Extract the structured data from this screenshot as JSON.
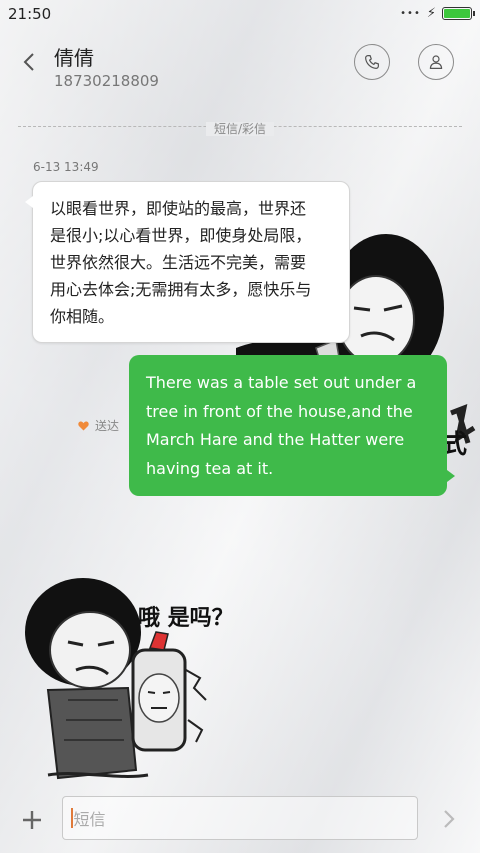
{
  "status_bar": {
    "time": "21:50",
    "dots": "•••",
    "charging": "⚡",
    "battery_level": 1.0
  },
  "header": {
    "name": "倩倩",
    "number": "18730218809"
  },
  "channel_label": "短信/彩信",
  "messages": [
    {
      "timestamp": "6-13 13:49",
      "lines": [
        "以眼看世界，即使站的最高，世界还",
        "是很小;以心看世界，即使身处局限，",
        "世界依然很大。生活远不完美，需要",
        "用心去体会;无需拥有太多，愿快乐与",
        "你相随。"
      ]
    },
    {
      "lines": [
        "There was a table set out under a",
        "tree in front of the house,and the",
        "March Hare and the Hatter were",
        "having tea at it."
      ],
      "status": "送达"
    }
  ],
  "stickers": {
    "sticker2_caption": "哦 是吗？",
    "sticker1_edge_text": "式"
  },
  "composer": {
    "placeholder": "短信"
  },
  "colors": {
    "bubble_out": "#3fba4a",
    "accent": "#e07a3a"
  },
  "icons": [
    "back-arrow-icon",
    "phone-icon",
    "profile-icon",
    "heart-icon",
    "plus-icon",
    "send-arrow-icon"
  ]
}
